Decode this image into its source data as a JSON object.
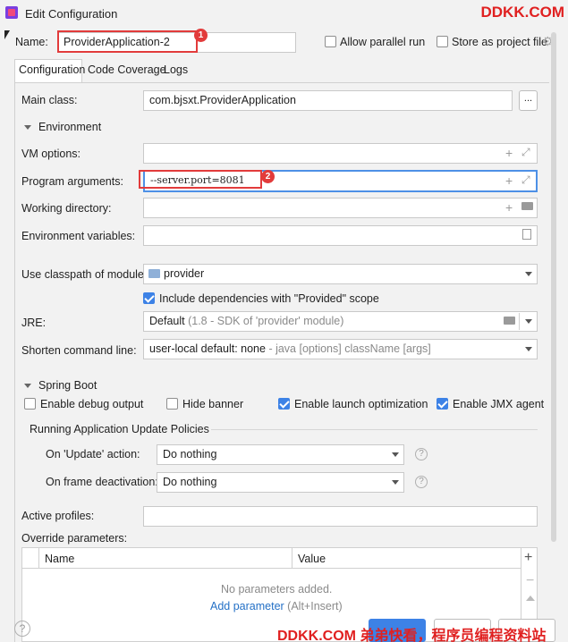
{
  "window": {
    "title": "Edit Configuration"
  },
  "watermark_top": "DDKK.COM",
  "watermark_bottom": "DDKK.COM 弟弟快看，程序员编程资料站",
  "name_row": {
    "label": "Name:",
    "value": "ProviderApplication-2",
    "badge": "1",
    "allow_parallel_label": "Allow parallel run",
    "store_project_label": "Store as project file"
  },
  "tabs": [
    "Configuration",
    "Code Coverage",
    "Logs"
  ],
  "main_class": {
    "label": "Main class:",
    "value": "com.bjsxt.ProviderApplication",
    "browse": "..."
  },
  "environment": {
    "header": "Environment",
    "vm_options": {
      "label": "VM options:",
      "value": ""
    },
    "program_arguments": {
      "label": "Program arguments:",
      "value": "--server.port=8081",
      "badge": "2"
    },
    "working_directory": {
      "label": "Working directory:",
      "value": ""
    },
    "environment_variables": {
      "label": "Environment variables:",
      "value": ""
    }
  },
  "classpath": {
    "label": "Use classpath of module:",
    "value": "provider",
    "include_deps_label": "Include dependencies with \"Provided\" scope",
    "include_deps_checked": true
  },
  "jre": {
    "label": "JRE:",
    "value": "Default",
    "hint": "(1.8 - SDK of 'provider' module)"
  },
  "shorten": {
    "label": "Shorten command line:",
    "value": "user-local default: none",
    "hint": "- java [options] className [args]"
  },
  "spring_boot": {
    "header": "Spring Boot",
    "enable_debug_output": {
      "label": "Enable debug output",
      "checked": false
    },
    "hide_banner": {
      "label": "Hide banner",
      "checked": false
    },
    "enable_launch_optimization": {
      "label": "Enable launch optimization",
      "checked": true
    },
    "enable_jmx_agent": {
      "label": "Enable JMX agent",
      "checked": true
    },
    "policies_header": "Running Application Update Policies",
    "on_update": {
      "label": "On 'Update' action:",
      "value": "Do nothing"
    },
    "on_frame": {
      "label": "On frame deactivation:",
      "value": "Do nothing"
    }
  },
  "active_profiles": {
    "label": "Active profiles:",
    "value": ""
  },
  "override": {
    "label": "Override parameters:",
    "columns": [
      "Name",
      "Value"
    ],
    "empty_text": "No parameters added.",
    "add_link": "Add parameter",
    "add_shortcut": "(Alt+Insert)"
  },
  "help_icon": "?",
  "colors": {
    "accent": "#3d82e6",
    "highlight_box": "#e23b3b",
    "watermark": "#e02020"
  }
}
